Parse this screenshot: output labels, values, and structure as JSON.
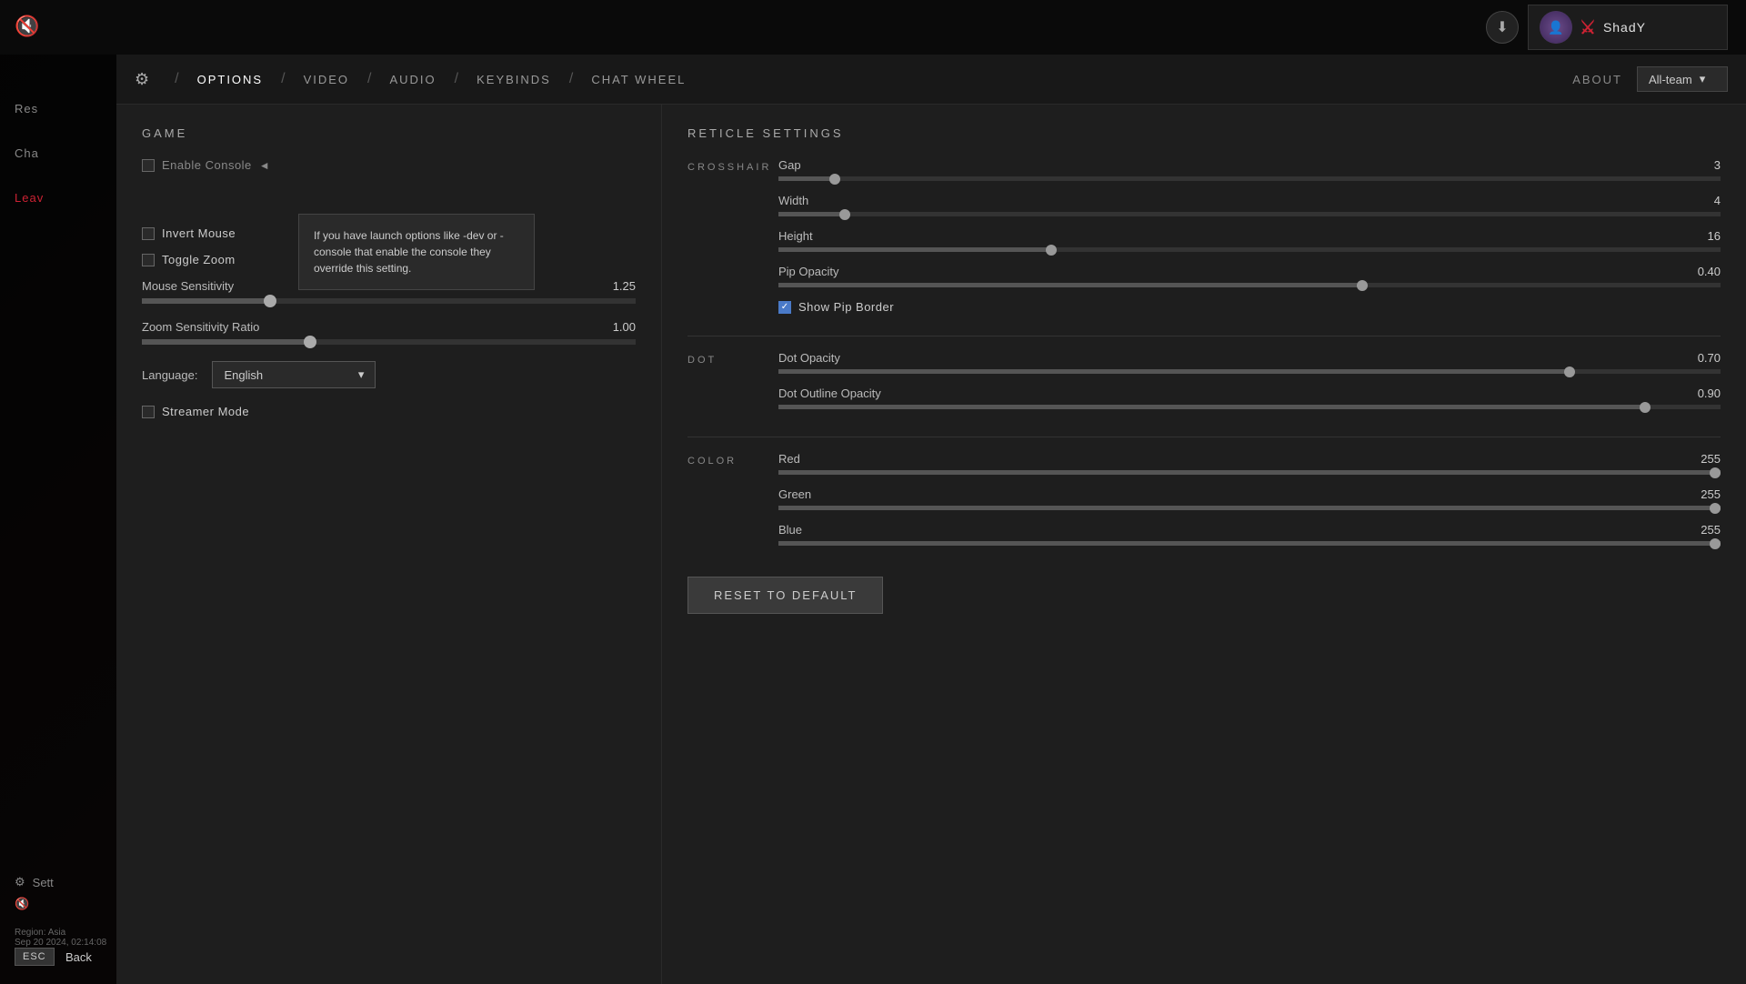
{
  "app": {
    "muted_icon": "🔇"
  },
  "topbar": {
    "download_icon": "⬇",
    "user_name": "ShadY",
    "all_team_label": "All-team",
    "chevron_down": "▾"
  },
  "nav": {
    "gear_icon": "⚙",
    "separator": "/",
    "tabs": [
      {
        "label": "OPTIONS",
        "active": true
      },
      {
        "label": "VIDEO",
        "active": false
      },
      {
        "label": "AUDIO",
        "active": false
      },
      {
        "label": "KEYBINDS",
        "active": false
      },
      {
        "label": "CHAT WHEEL",
        "active": false
      }
    ],
    "about_label": "ABOUT"
  },
  "sidebar": {
    "items": [
      {
        "label": "Res",
        "active": false
      },
      {
        "label": "Cha",
        "active": false
      },
      {
        "label": "Leav",
        "active": false
      }
    ],
    "settings_label": "Sett",
    "gear_icon": "⚙",
    "volume_icon": "🔇",
    "esc_label": "ESC",
    "back_label": "Back",
    "region_label": "Region: Asia",
    "date_label": "Sep 20 2024, 02:14:08"
  },
  "game_section": {
    "title": "GAME",
    "tooltip": {
      "text": "If you have launch options like -dev or -console that enable the console they override this setting."
    },
    "options": [
      {
        "label": "Enable Console",
        "checked": false,
        "has_info": true
      },
      {
        "label": "Invert Mouse",
        "checked": false
      },
      {
        "label": "Toggle Zoom",
        "checked": false
      }
    ],
    "sliders": [
      {
        "label": "Mouse Sensitivity",
        "value": "1.25",
        "fill_pct": 26,
        "thumb_pct": 26
      },
      {
        "label": "Zoom Sensitivity Ratio",
        "value": "1.00",
        "fill_pct": 34,
        "thumb_pct": 34
      }
    ],
    "language": {
      "label": "Language:",
      "value": "English",
      "chevron": "▾"
    },
    "streamer_mode": {
      "label": "Streamer Mode",
      "checked": false
    }
  },
  "reticle": {
    "title": "RETICLE SETTINGS",
    "crosshair": {
      "section_label": "CROSSHAIR",
      "sliders": [
        {
          "label": "Gap",
          "value": "3",
          "fill_pct": 6,
          "thumb_pct": 6
        },
        {
          "label": "Width",
          "value": "4",
          "fill_pct": 7,
          "thumb_pct": 7
        },
        {
          "label": "Height",
          "value": "16",
          "fill_pct": 29,
          "thumb_pct": 29
        },
        {
          "label": "Pip Opacity",
          "value": "0.40",
          "fill_pct": 62,
          "thumb_pct": 62
        }
      ],
      "checkbox": {
        "label": "Show Pip Border",
        "checked": true
      }
    },
    "dot": {
      "section_label": "DOT",
      "sliders": [
        {
          "label": "Dot Opacity",
          "value": "0.70",
          "fill_pct": 84,
          "thumb_pct": 84
        },
        {
          "label": "Dot Outline Opacity",
          "value": "0.90",
          "fill_pct": 92,
          "thumb_pct": 92
        }
      ]
    },
    "color": {
      "section_label": "COLOR",
      "sliders": [
        {
          "label": "Red",
          "value": "255",
          "fill_pct": 100,
          "thumb_pct": 100
        },
        {
          "label": "Green",
          "value": "255",
          "fill_pct": 100,
          "thumb_pct": 100
        },
        {
          "label": "Blue",
          "value": "255",
          "fill_pct": 100,
          "thumb_pct": 100
        }
      ]
    },
    "reset_button": "RESET TO DEFAULT"
  }
}
